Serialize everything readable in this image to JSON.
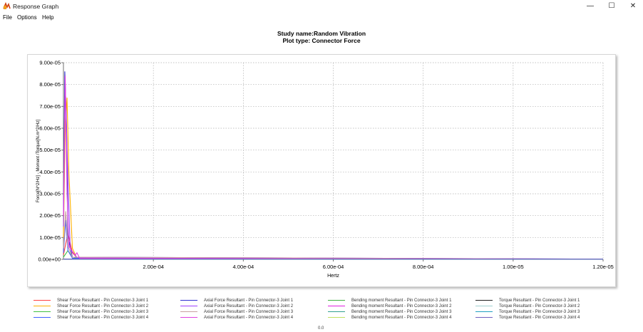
{
  "window": {
    "title": "Response Graph",
    "icon": "response-graph-app-icon",
    "controls": {
      "minimize": "—",
      "maximize": "☐",
      "close": "✕"
    }
  },
  "menu": [
    "File",
    "Options",
    "Help"
  ],
  "plot": {
    "title_line1": "Study name:Random Vibration",
    "title_line2": "Plot type: Connector Force"
  },
  "chart_data": {
    "type": "line",
    "title": "Study name:Random Vibration",
    "subtitle": "Plot type: Connector Force",
    "xlabel": "Hertz",
    "ylabel": "Force[N^2/Hz] - Moment /Torque[N.m^2/Hz]",
    "xlim": [
      0,
      0.0012
    ],
    "ylim": [
      0,
      9e-05
    ],
    "x_tick_values": [
      0.0002,
      0.0004,
      0.0006,
      0.0008,
      0.001,
      0.0012
    ],
    "x_tick_labels": [
      "2.00e-04",
      "4.00e-04",
      "6.00e-04",
      "8.00e-04",
      "1.00e-05",
      "1.20e-05"
    ],
    "y_tick_values": [
      0,
      1e-05,
      2e-05,
      3e-05,
      4e-05,
      5e-05,
      6e-05,
      7e-05,
      8e-05,
      9e-05
    ],
    "y_tick_labels": [
      "0.00e+00",
      "1.00e-05",
      "2.00e-05",
      "3.00e-05",
      "4.00e-05",
      "5.00e-05",
      "6.00e-05",
      "7.00e-05",
      "8.00e-05",
      "9.00e-05"
    ],
    "grid": true,
    "legend_position": "bottom",
    "series": [
      {
        "name": "Shear Force Resultant - Pin Connector-3 Joint 1",
        "color": "#ff4040",
        "x": [
          0,
          1e-05,
          2e-05,
          3e-05,
          5e-05,
          0.0012
        ],
        "y": [
          2e-06,
          1.2e-05,
          3e-06,
          8e-07,
          1e-07,
          1e-07
        ]
      },
      {
        "name": "Shear Force Resultant - Pin Connector-3 Joint 2",
        "color": "#ffb000",
        "x": [
          0,
          4e-06,
          8e-06,
          1.2e-05,
          2e-05,
          3e-05,
          0.0012
        ],
        "y": [
          1e-05,
          6e-05,
          7.4e-05,
          4e-05,
          5e-06,
          5e-07,
          1e-07
        ]
      },
      {
        "name": "Shear Force Resultant - Pin Connector-3 Joint 3",
        "color": "#40c040",
        "x": [
          0,
          1e-05,
          2e-05,
          4e-05,
          0.0012
        ],
        "y": [
          1e-06,
          4e-06,
          1e-06,
          2e-07,
          1e-07
        ]
      },
      {
        "name": "Shear Force Resultant - Pin Connector-3 Joint 4",
        "color": "#4060ff",
        "x": [
          0,
          5e-06,
          1e-05,
          2e-05,
          0.0012
        ],
        "y": [
          3e-06,
          1.8e-05,
          4e-06,
          5e-07,
          1e-07
        ]
      },
      {
        "name": "Axial Force Resultant - Pin Connector-3 Joint 1",
        "color": "#3030d0",
        "x": [
          0,
          3e-06,
          7e-06,
          1e-05,
          2e-05,
          0.0012
        ],
        "y": [
          2e-05,
          8.6e-05,
          6e-05,
          1e-05,
          1e-06,
          1e-07
        ]
      },
      {
        "name": "Axial Force Resultant - Pin Connector-3 Joint 2",
        "color": "#a040ff",
        "x": [
          0,
          4e-06,
          8e-06,
          1.5e-05,
          3e-05,
          0.0012
        ],
        "y": [
          1.5e-05,
          8e-05,
          5e-05,
          5e-06,
          8e-07,
          1e-07
        ]
      },
      {
        "name": "Axial Force Resultant - Pin Connector-3 Joint 3",
        "color": "#c8a0a0",
        "x": [
          0,
          5e-06,
          1e-05,
          2e-05,
          0.0012
        ],
        "y": [
          5e-06,
          2.2e-05,
          6e-06,
          1e-06,
          1e-07
        ]
      },
      {
        "name": "Axial Force Resultant - Pin Connector-3 Joint 4",
        "color": "#e040e0",
        "x": [
          0,
          4e-06,
          8e-06,
          1.2e-05,
          2e-05,
          2.6e-05,
          3e-05,
          3.6e-05,
          0.0012
        ],
        "y": [
          2e-05,
          8.4e-05,
          3e-05,
          6e-06,
          3.5e-06,
          1.8e-06,
          3e-06,
          5e-07,
          1e-07
        ]
      },
      {
        "name": "Bending moment Resultant - Pin Connector-3 Joint 1",
        "color": "#40b040",
        "x": [
          0,
          0.0012
        ],
        "y": [
          1e-07,
          1e-07
        ]
      },
      {
        "name": "Bending moment Resultant - Pin Connector-3 Joint 2",
        "color": "#e020e0",
        "x": [
          0,
          0.0012
        ],
        "y": [
          1e-07,
          1e-07
        ]
      },
      {
        "name": "Bending moment Resultant - Pin Connector-3 Joint 3",
        "color": "#30a090",
        "x": [
          0,
          0.0012
        ],
        "y": [
          1e-07,
          1e-07
        ]
      },
      {
        "name": "Bending moment Resultant - Pin Connector-3 Joint 4",
        "color": "#c0e060",
        "x": [
          0,
          0.0012
        ],
        "y": [
          1e-07,
          1e-07
        ]
      },
      {
        "name": "Torque Resultant - Pin Connector-3 Joint 1",
        "color": "#202020",
        "x": [
          0,
          0.0012
        ],
        "y": [
          1e-07,
          1e-07
        ]
      },
      {
        "name": "Torque Resultant - Pin Connector-3 Joint 2",
        "color": "#a0d0d0",
        "x": [
          0,
          0.0012
        ],
        "y": [
          1e-07,
          1e-07
        ]
      },
      {
        "name": "Torque Resultant - Pin Connector-3 Joint 3",
        "color": "#20a0c0",
        "x": [
          0,
          0.0012
        ],
        "y": [
          1e-07,
          1e-07
        ]
      },
      {
        "name": "Torque Resultant - Pin Connector-3 Joint 4",
        "color": "#7060c0",
        "x": [
          0,
          0.0012
        ],
        "y": [
          1e-07,
          1e-07
        ]
      }
    ]
  },
  "footer_text": "0.0"
}
